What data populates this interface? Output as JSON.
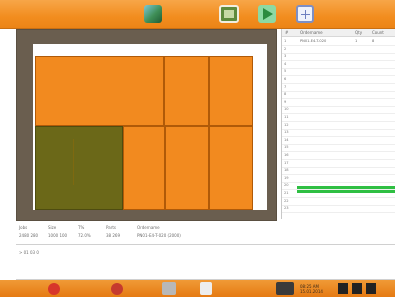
{
  "toolbar": {
    "icons": [
      "box-icon",
      "image-icon",
      "play-icon",
      "grid-icon"
    ]
  },
  "canvas": {
    "sheet_color": "#ffffff",
    "frame_color": "#6a5e4f",
    "part_colors": {
      "orange": "#f28a1f",
      "olive": "#6b6818"
    }
  },
  "list": {
    "headers": [
      "#",
      "Ordername",
      "Qty",
      "Count"
    ],
    "row_numbers": [
      "1",
      "2",
      "3",
      "4",
      "5",
      "6",
      "7",
      "8",
      "9",
      "10",
      "11",
      "12",
      "13",
      "14",
      "15",
      "16",
      "17",
      "18",
      "19",
      "20",
      "21",
      "22",
      "23"
    ],
    "first_row": {
      "name": "PN01-E4-T-020",
      "qty": "1",
      "count": "8"
    },
    "highlight_color": "#2fbf43"
  },
  "info": {
    "headers": [
      "Jobs",
      "Size",
      "T%",
      "Parts",
      "Ordername"
    ],
    "values": [
      "2480 280",
      "1000 100",
      "72.0%",
      "38 269",
      "PN01-E4-T-020 (2000)"
    ]
  },
  "log": {
    "line": "> 01 03 0"
  },
  "taskbar": {
    "clock": "08:25 AM",
    "date": "15.01.2014",
    "status_color": "#e57a13"
  }
}
